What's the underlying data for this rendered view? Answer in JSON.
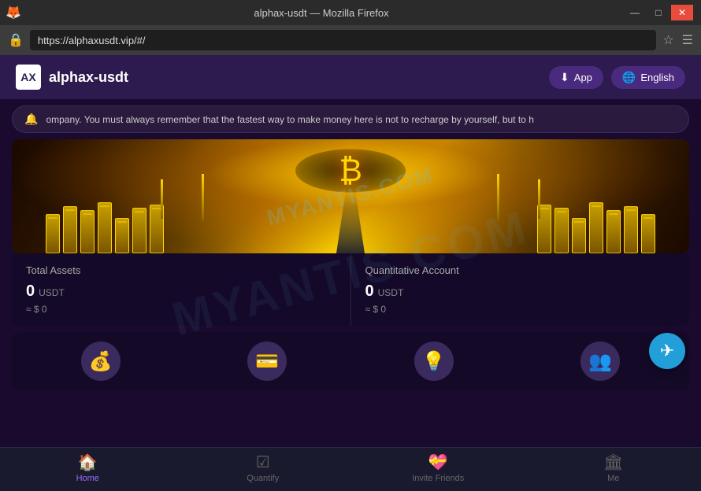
{
  "browser": {
    "title": "alphax-usdt — Mozilla Firefox",
    "url": "https://alphaxusdt.vip/#/",
    "favicon": "🦊"
  },
  "header": {
    "logo_text": "AX",
    "site_name": "alphax-usdt",
    "app_button": "App",
    "language_button": "English",
    "app_icon": "⬇",
    "globe_icon": "🌐"
  },
  "notification": {
    "text": "ompany. You must always remember that the fastest way to make money here is not to recharge by yourself, but to h"
  },
  "hero": {
    "watermark": "MYANTIS.COM"
  },
  "total_assets": {
    "title": "Total Assets",
    "amount": "0",
    "unit": "USDT",
    "usd_value": "≈ $ 0"
  },
  "quantitative_account": {
    "title": "Quantitative Account",
    "amount": "0",
    "unit": "USDT",
    "usd_value": "≈ $ 0"
  },
  "quick_actions": [
    {
      "icon": "💰",
      "color": "#9b6dff"
    },
    {
      "icon": "💳",
      "color": "#9b6dff"
    },
    {
      "icon": "💡",
      "color": "#9b6dff"
    },
    {
      "icon": "👥",
      "color": "#9b6dff"
    }
  ],
  "bottom_nav": [
    {
      "id": "home",
      "label": "Home",
      "icon": "🏠",
      "active": true
    },
    {
      "id": "quantify",
      "label": "Quantify",
      "icon": "✅",
      "active": false
    },
    {
      "id": "invite",
      "label": "Invite Friends",
      "icon": "💝",
      "active": false
    },
    {
      "id": "me",
      "label": "Me",
      "icon": "🏛",
      "active": false
    }
  ],
  "window_controls": {
    "minimize": "—",
    "maximize": "□",
    "close": "✕"
  }
}
